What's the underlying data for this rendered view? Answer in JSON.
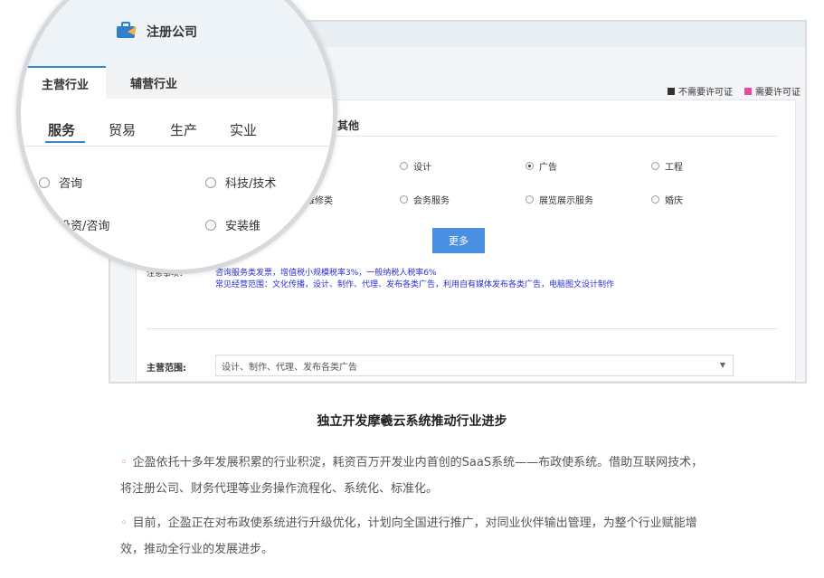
{
  "app": {
    "title": "注册公司"
  },
  "tabs": {
    "main": "主营行业",
    "secondary": "辅营行业"
  },
  "legend": {
    "no_license": "不需要许可证",
    "need_license": "需要许可证",
    "no_license_color": "#333333",
    "need_license_color": "#e94aa1"
  },
  "subtabs": {
    "service": "服务",
    "trade": "贸易",
    "production": "生产",
    "industry": "实业",
    "other": "其他"
  },
  "options": {
    "consulting": "咨询",
    "tech": "科技/技术",
    "design": "设计",
    "ad": "广告",
    "engineering": "工程",
    "investment": "投资/咨询",
    "install": "安装维修类",
    "conference": "会务服务",
    "exhibition": "展览展示服务",
    "celebration": "婚庆"
  },
  "lens_options": {
    "install_partial": "安装维"
  },
  "more_button": "更多",
  "notes": {
    "tax": "咨询服务类发票，增值税小规模税率3%，一般纳税人税率6%",
    "scope": "常见经营范围：文化传播，设计、制作、代理、发布各类广告，利用自有媒体发布各类广告，电脑图文设计制作",
    "label_partial": "注意事项："
  },
  "scope": {
    "label": "主营范围:",
    "value": "设计、制作、代理、发布各类广告"
  },
  "headline": "独立开发摩羲云系统推动行业进步",
  "paragraphs": [
    "企盈依托十多年发展积累的行业积淀，耗资百万开发业内首创的SaaS系统——布政使系统。借助互联网技术，将注册公司、财务代理等业务操作流程化、系统化、标准化。",
    "目前，企盈正在对布政使系统进行升级优化，计划向全国进行推广，对同业伙伴输出管理，为整个行业赋能增效，推动全行业的发展进步。"
  ]
}
